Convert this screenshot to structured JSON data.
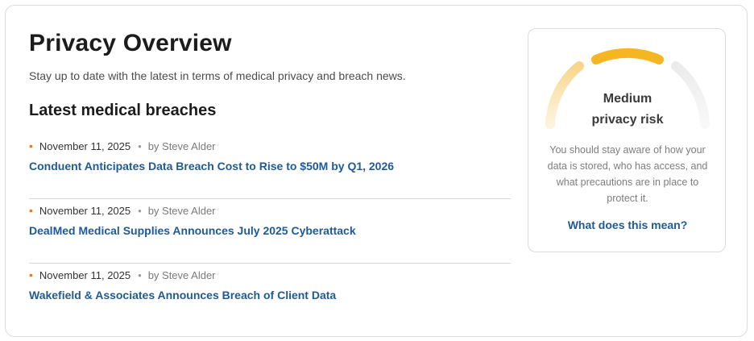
{
  "page": {
    "title": "Privacy Overview",
    "subtitle": "Stay up to date with the latest in terms of medical privacy and breach news.",
    "section_title": "Latest medical breaches"
  },
  "articles": [
    {
      "date": "November 11, 2025",
      "author": "by Steve Alder",
      "headline": "Conduent Anticipates Data Breach Cost to Rise to $50M by Q1, 2026"
    },
    {
      "date": "November 11, 2025",
      "author": "by Steve Alder",
      "headline": "DealMed Medical Supplies Announces July 2025 Cyberattack"
    },
    {
      "date": "November 11, 2025",
      "author": "by Steve Alder",
      "headline": "Wakefield & Associates Announces Breach of Client Data"
    }
  ],
  "risk": {
    "label": "Medium\nprivacy risk",
    "level": "medium",
    "description": "You should stay aware of how your data is stored, who has access, and what precautions are in place to protect it.",
    "link": "What does this mean?"
  },
  "colors": {
    "accent_link": "#1f5a97",
    "bullet": "#e07b1f",
    "gauge_active": "#f6b623",
    "gauge_faded": "#f8d58a",
    "gauge_inactive": "#ececec"
  },
  "icons": {
    "bullet": "bullet-dot-icon",
    "separator": "separator-dot-icon"
  }
}
